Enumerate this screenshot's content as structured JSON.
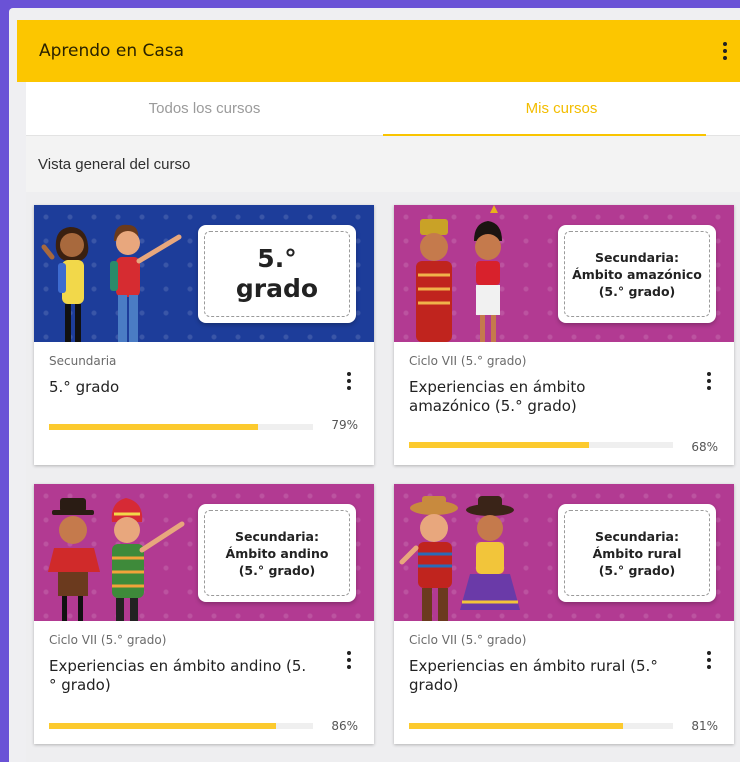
{
  "app": {
    "title": "Aprendo en Casa"
  },
  "tabs": [
    {
      "label": "Todos los cursos",
      "active": false
    },
    {
      "label": "Mis cursos",
      "active": true
    }
  ],
  "subheader": {
    "title": "Vista general del curso"
  },
  "colors": {
    "accent": "#fcc600",
    "progress": "#fcca2e",
    "banner_blue": "#1d3d9a",
    "banner_pink": "#b23a92"
  },
  "courses": [
    {
      "banner_label": "5.° grado",
      "category": "Secundaria",
      "title": "5.° grado",
      "progress_percent": 79,
      "progress_label": "79%"
    },
    {
      "banner_label": "Secundaria:\nÁmbito amazónico\n(5.° grado)",
      "category": "Ciclo VII (5.° grado)",
      "title": "Experiencias en ámbito amazónico (5.° grado)",
      "progress_percent": 68,
      "progress_label": "68%"
    },
    {
      "banner_label": "Secundaria:\nÁmbito andino\n(5.° grado)",
      "category": "Ciclo VII (5.° grado)",
      "title": "Experiencias en ámbito andino (5.° grado)",
      "progress_percent": 86,
      "progress_label": "86%"
    },
    {
      "banner_label": "Secundaria:\nÁmbito rural\n(5.° grado)",
      "category": "Ciclo VII (5.° grado)",
      "title": "Experiencias en ámbito rural (5.° grado)",
      "progress_percent": 81,
      "progress_label": "81%"
    }
  ]
}
